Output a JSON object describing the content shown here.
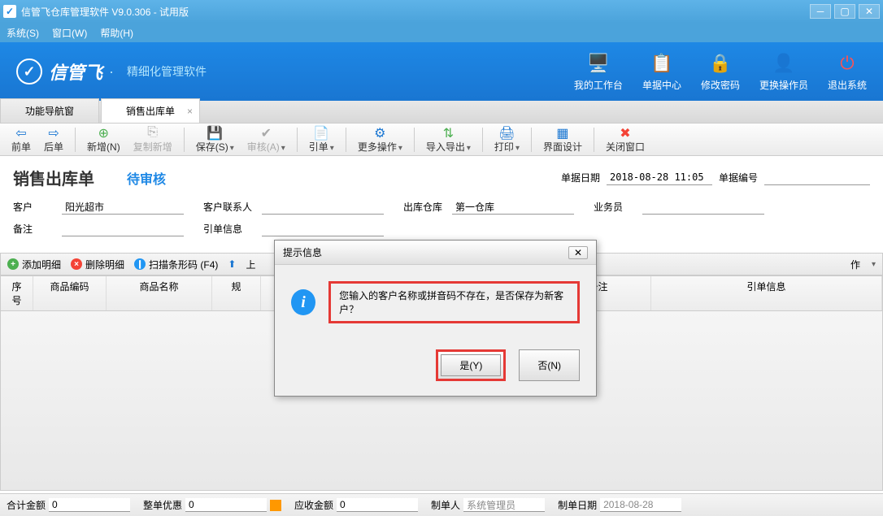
{
  "window": {
    "title": "信管飞仓库管理软件 V9.0.306 - 试用版"
  },
  "menubar": {
    "system": "系统(S)",
    "window": "窗口(W)",
    "help": "帮助(H)"
  },
  "header": {
    "logo_text": "信管飞",
    "logo_dot": "·",
    "logo_sub": "精细化管理软件",
    "actions": {
      "workbench": "我的工作台",
      "bill_center": "单据中心",
      "change_pwd": "修改密码",
      "switch_user": "更换操作员",
      "exit": "退出系统"
    }
  },
  "tabs": {
    "nav": "功能导航窗",
    "sales": "销售出库单"
  },
  "toolbar": {
    "prev": "前单",
    "next": "后单",
    "new": "新增(N)",
    "copy": "复制新增",
    "save": "保存(S)",
    "audit": "审核(A)",
    "ref": "引单",
    "more": "更多操作",
    "import": "导入导出",
    "print": "打印",
    "layout": "界面设计",
    "close": "关闭窗口"
  },
  "form": {
    "title": "销售出库单",
    "status": "待审核",
    "date_label": "单据日期",
    "date_value": "2018-08-28 11:05",
    "billno_label": "单据编号",
    "billno_value": "",
    "customer_label": "客户",
    "customer_value": "阳光超市",
    "contact_label": "客户联系人",
    "contact_value": "",
    "warehouse_label": "出库仓库",
    "warehouse_value": "第一仓库",
    "salesman_label": "业务员",
    "salesman_value": "",
    "remark_label": "备注",
    "remark_value": "",
    "refinfo_label": "引单信息",
    "refinfo_value": ""
  },
  "detail_toolbar": {
    "add": "添加明细",
    "del": "删除明细",
    "scan": "扫描条形码 (F4)",
    "up": "上",
    "ops": "作"
  },
  "grid": {
    "cols": [
      "序号",
      "商品编码",
      "商品名称",
      "规",
      "",
      "",
      "",
      "",
      "",
      "备注",
      "引单信息"
    ]
  },
  "footer": {
    "total_label": "合计金额",
    "total_value": "0",
    "discount_label": "整单优惠",
    "discount_value": "0",
    "receivable_label": "应收金额",
    "receivable_value": "0",
    "maker_label": "制单人",
    "maker_value": "系统管理员",
    "make_date_label": "制单日期",
    "make_date_value": "2018-08-28"
  },
  "dialog": {
    "title": "提示信息",
    "message": "您输入的客户名称或拼音码不存在，是否保存为新客户？",
    "yes": "是(Y)",
    "no": "否(N)"
  }
}
